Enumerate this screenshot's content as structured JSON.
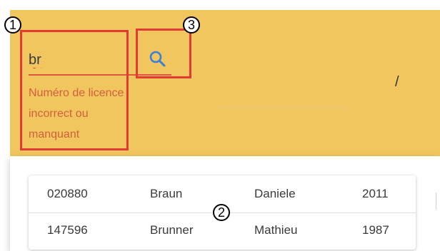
{
  "search": {
    "value": "br",
    "icon": "search-icon",
    "error_text": "Numéro de licence incorrect ou manquant"
  },
  "header": {
    "separator": "/",
    "background_color": "#f2c65e"
  },
  "annotations": {
    "marker_1": "1",
    "marker_2": "2",
    "marker_3": "3",
    "color": "#e33b34"
  },
  "results": {
    "rows": [
      {
        "license": "020880",
        "last_name": "Braun",
        "first_name": "Daniele",
        "year": "2011"
      },
      {
        "license": "147596",
        "last_name": "Brunner",
        "first_name": "Mathieu",
        "year": "1987"
      }
    ]
  }
}
